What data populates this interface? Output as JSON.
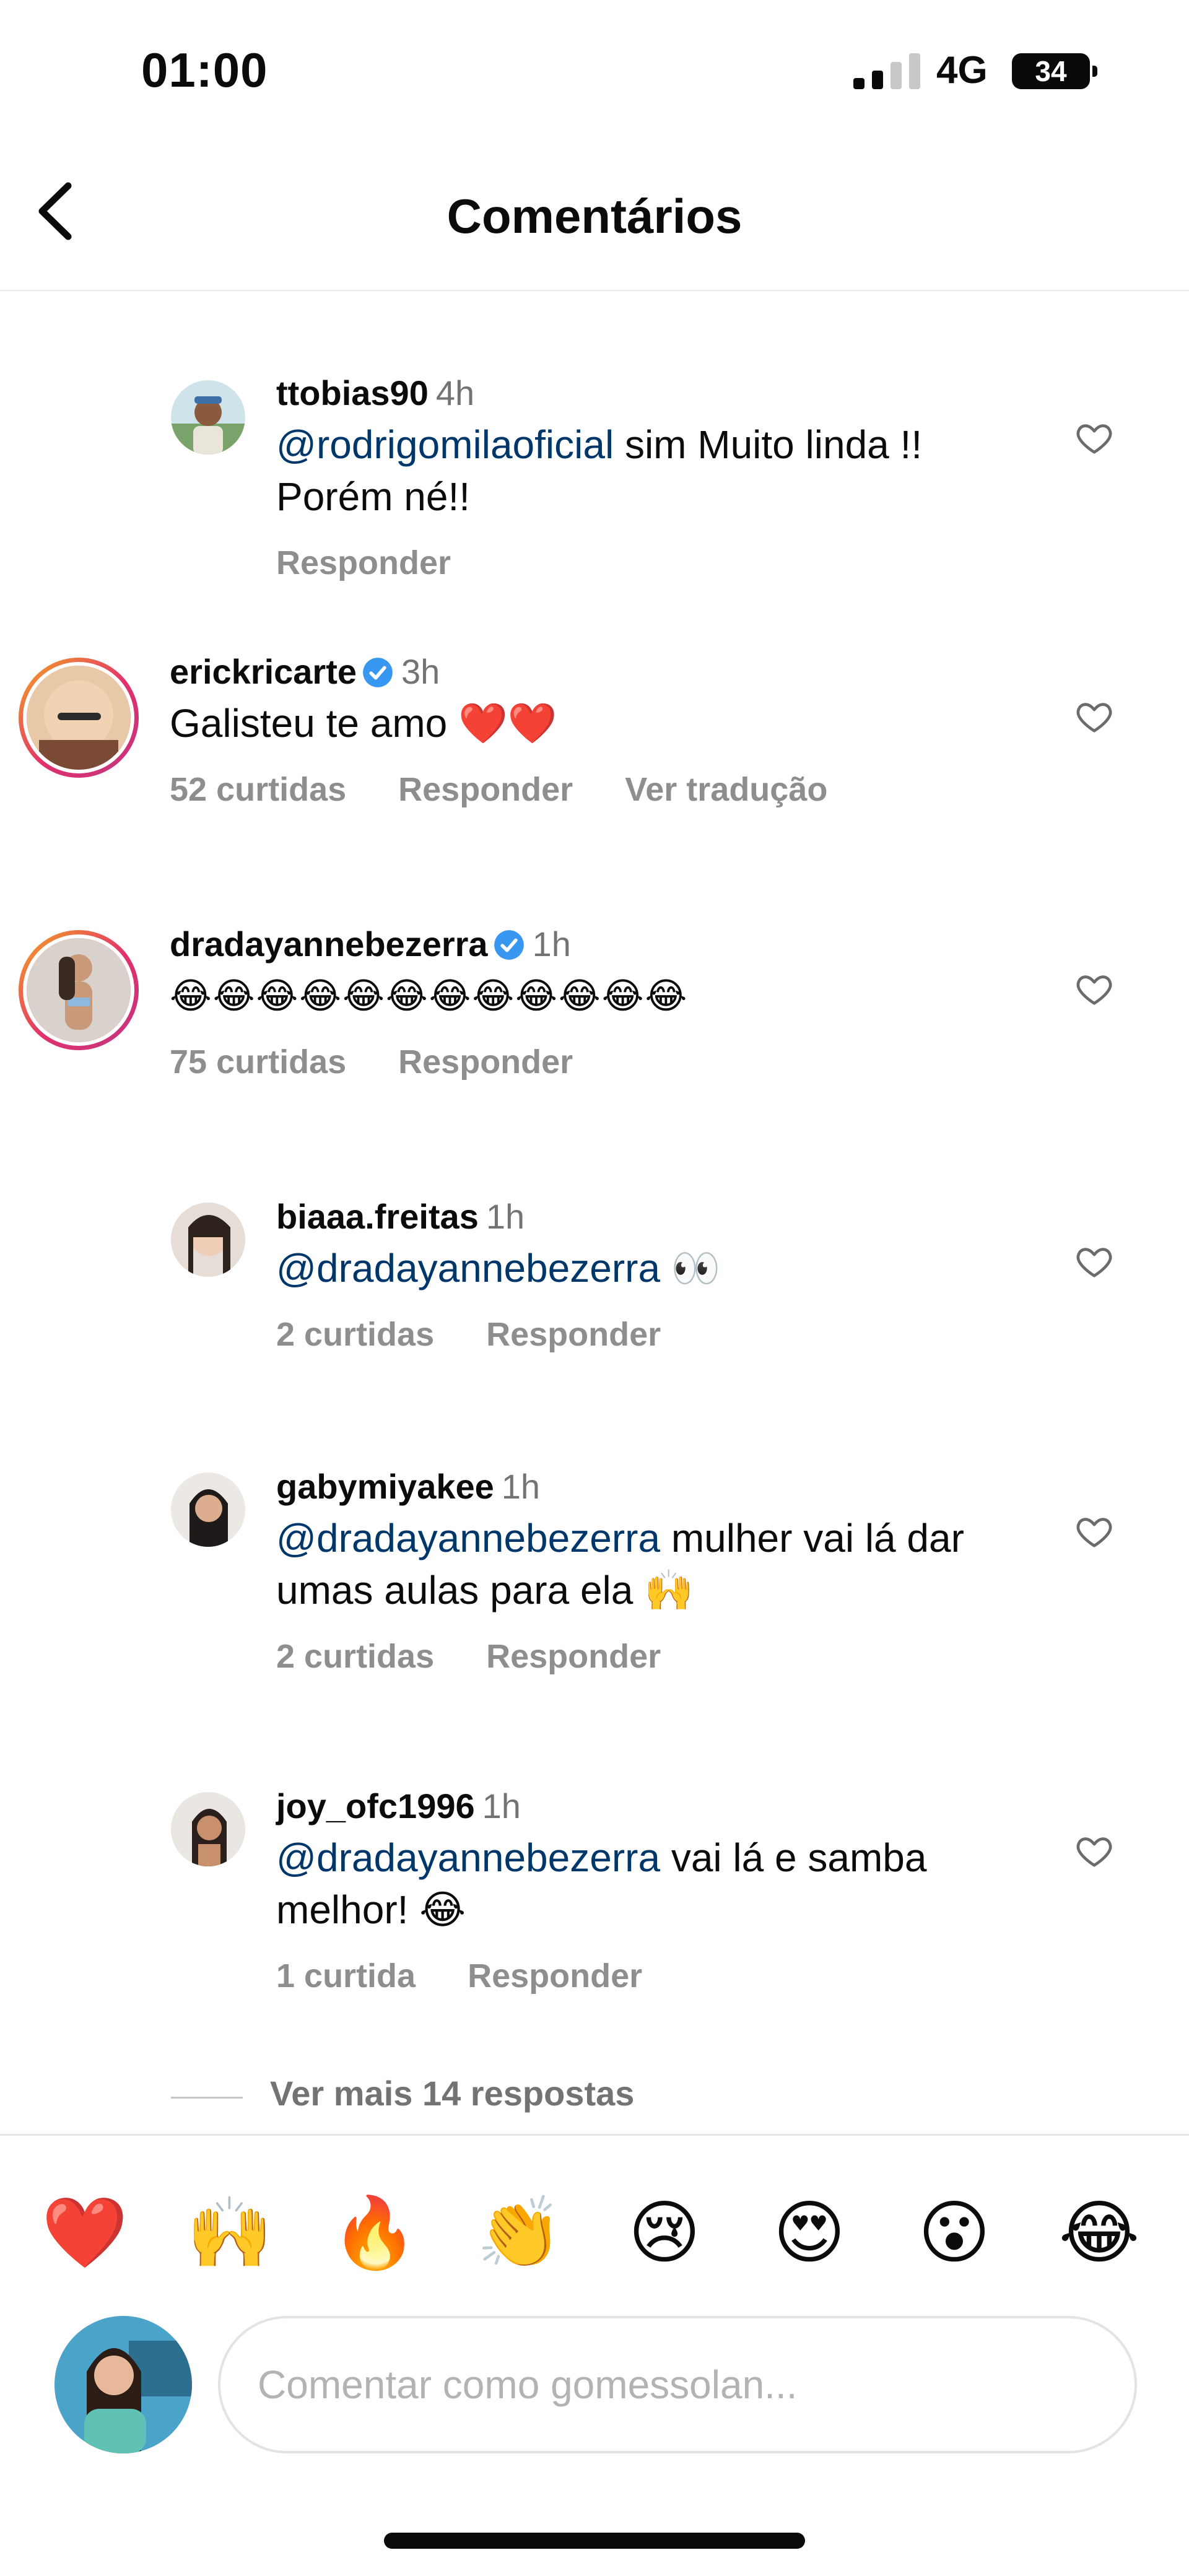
{
  "status": {
    "time": "01:00",
    "network": "4G",
    "battery": "34"
  },
  "header": {
    "title": "Comentários"
  },
  "colors": {
    "accent_link": "#00376b",
    "muted": "#8e8e8e",
    "verified": "#3897f0"
  },
  "comments": [
    {
      "username": "ttobias90",
      "time": "4h",
      "verified": false,
      "mention": "@rodrigomilaoficial",
      "text": " sim Muito linda !! Porém né!!",
      "likes": "",
      "reply": "Responder",
      "translate": ""
    },
    {
      "username": "erickricarte",
      "time": "3h",
      "verified": true,
      "mention": "",
      "text": "Galisteu te amo ❤️❤️",
      "likes": "52 curtidas",
      "reply": "Responder",
      "translate": "Ver tradução"
    },
    {
      "username": "dradayannebezerra",
      "time": "1h",
      "verified": true,
      "mention": "",
      "text": "😂😂😂😂😂😂😂😂😂😂😂😂",
      "likes": "75 curtidas",
      "reply": "Responder",
      "translate": ""
    },
    {
      "username": "biaaa.freitas",
      "time": "1h",
      "verified": false,
      "mention": "@dradayannebezerra",
      "text": " 👀",
      "likes": "2 curtidas",
      "reply": "Responder",
      "translate": ""
    },
    {
      "username": "gabymiyakee",
      "time": "1h",
      "verified": false,
      "mention": "@dradayannebezerra",
      "text": " mulher vai lá dar umas aulas para ela 🙌",
      "likes": "2 curtidas",
      "reply": "Responder",
      "translate": ""
    },
    {
      "username": "joy_ofc1996",
      "time": "1h",
      "verified": false,
      "mention": "@dradayannebezerra",
      "text": " vai lá e samba melhor! 😂",
      "likes": "1 curtida",
      "reply": "Responder",
      "translate": ""
    }
  ],
  "more_replies": "Ver mais 14 respostas",
  "reactions": [
    "❤️",
    "🙌",
    "🔥",
    "👏",
    "😢",
    "😍",
    "😮",
    "😂"
  ],
  "composer": {
    "placeholder": "Comentar como gomessolan..."
  }
}
